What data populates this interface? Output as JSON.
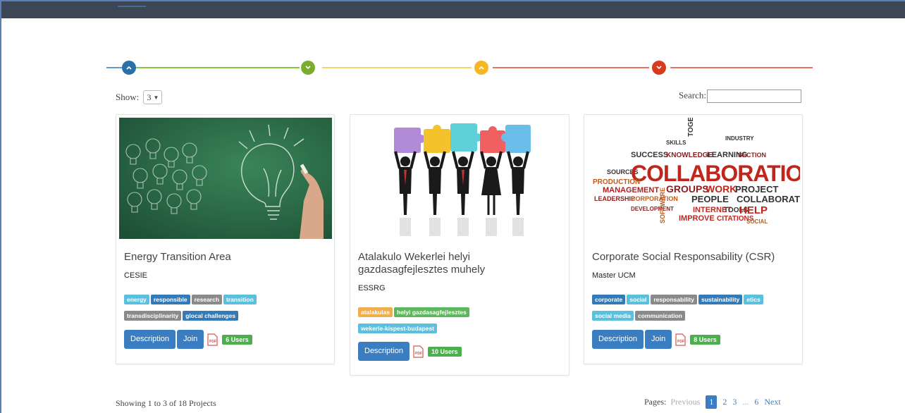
{
  "steps": [
    {
      "color": "#2b6fa6",
      "line": "#5b9bd5",
      "icon": "chevron-up"
    },
    {
      "color": "#7aac2d",
      "line": "#8cc63f",
      "icon": "chevron-down"
    },
    {
      "color": "#f4b826",
      "line": "#f5d66a",
      "icon": "chevron-up"
    },
    {
      "color": "#d83a1d",
      "line": "#e8705d",
      "icon": "chevron-down"
    }
  ],
  "controls": {
    "show_label": "Show:",
    "show_value": "3",
    "search_label": "Search:"
  },
  "projects": [
    {
      "title": "Energy Transition Area",
      "org": "CESIE",
      "tags": [
        {
          "label": "energy",
          "color": "blue"
        },
        {
          "label": "responsible",
          "color": "dark"
        },
        {
          "label": "research",
          "color": "grey"
        },
        {
          "label": "transition",
          "color": "blue"
        },
        {
          "label": "transdisciplinarity",
          "color": "grey"
        },
        {
          "label": "glocal challenges",
          "color": "dark"
        }
      ],
      "buttons": [
        "Description",
        "Join"
      ],
      "users": "6 Users"
    },
    {
      "title": "Atalakulo Wekerlei helyi gazdasagfejlesztes muhely",
      "org": "ESSRG",
      "tags": [
        {
          "label": "atalakulas",
          "color": "orange"
        },
        {
          "label": "helyi gazdasagfejlesztes",
          "color": "green"
        },
        {
          "label": "wekerle-kispest-budapest",
          "color": "blue"
        }
      ],
      "buttons": [
        "Description"
      ],
      "users": "10 Users"
    },
    {
      "title": "Corporate Social Responsability (CSR)",
      "org": "Master UCM",
      "tags": [
        {
          "label": "corporate",
          "color": "dark"
        },
        {
          "label": "social",
          "color": "blue"
        },
        {
          "label": "responsability",
          "color": "grey"
        },
        {
          "label": "sustainability",
          "color": "dark"
        },
        {
          "label": "etics",
          "color": "blue"
        },
        {
          "label": "social media",
          "color": "blue"
        },
        {
          "label": "communication",
          "color": "grey"
        }
      ],
      "buttons": [
        "Description",
        "Join"
      ],
      "users": "8 Users"
    }
  ],
  "wordcloud": {
    "main": "COLLABORATION",
    "words": [
      "TOGETHER",
      "SUCCESS",
      "KNOWLEDGE",
      "LEARNING",
      "SECTION",
      "SOURCES",
      "PRODUCTION",
      "MANAGEMENT",
      "GROUPS",
      "WORK",
      "PROJECT",
      "LEADERSHIP",
      "CORPORATION",
      "PEOPLE",
      "COLLABORATIVE",
      "INTERNET",
      "TOOLS",
      "HELP",
      "DEVELOPMENT",
      "SOFTWARE",
      "IMPROVE",
      "CITATIONS",
      "SOCIAL",
      "SKILLS",
      "INDUSTRY"
    ]
  },
  "footer": {
    "showing": "Showing 1 to 3 of 18 Projects",
    "pages_label": "Pages:",
    "previous": "Previous",
    "pages": [
      "1",
      "2",
      "3",
      "...",
      "6"
    ],
    "next": "Next"
  }
}
